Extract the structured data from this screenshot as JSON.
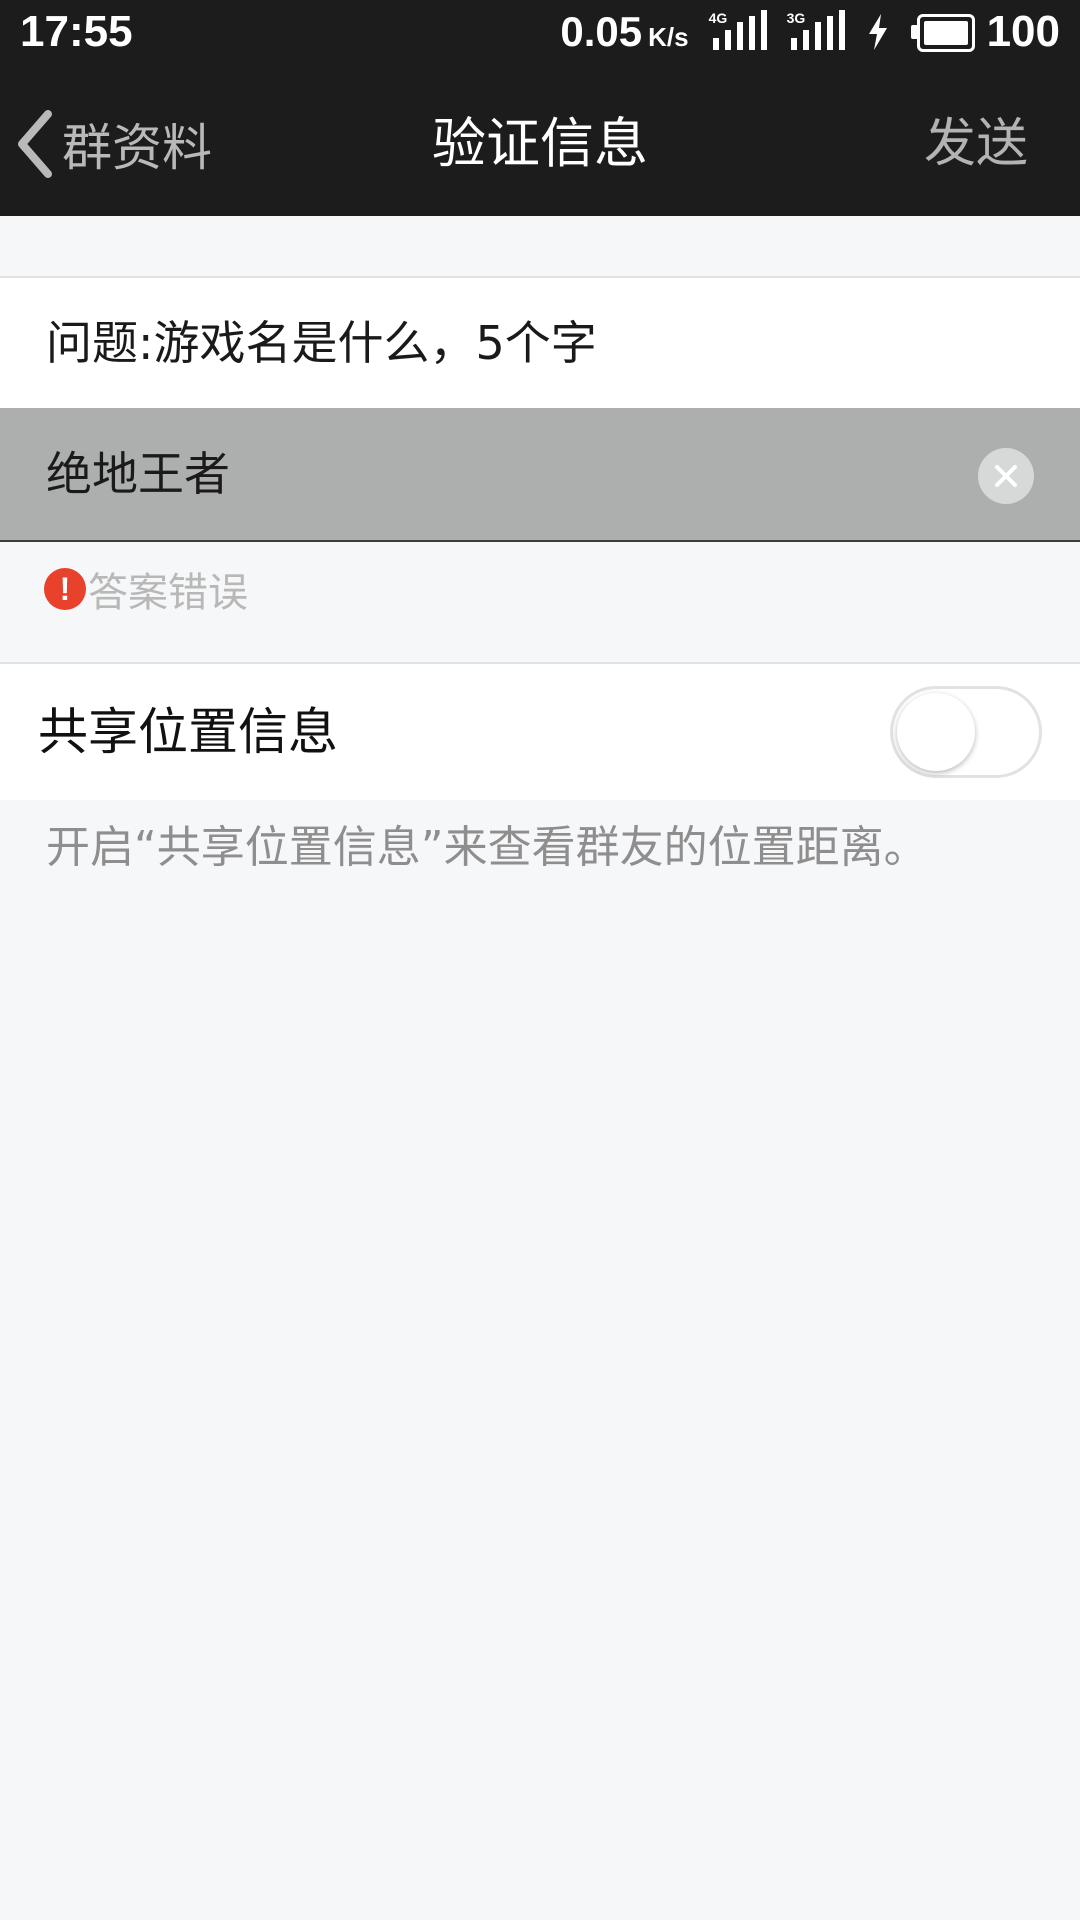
{
  "status_bar": {
    "time": "17:55",
    "net_speed": "0.05",
    "net_speed_unit": "K/s",
    "signal_1_tag": "4G",
    "signal_2_tag": "3G",
    "battery_level": "100",
    "icons": [
      "signal-icon",
      "signal-icon",
      "charging-icon",
      "battery-icon"
    ]
  },
  "nav": {
    "back_label": "群资料",
    "title": "验证信息",
    "send_label": "发送"
  },
  "form": {
    "question": "问题:游戏名是什么，5个字",
    "answer_value": "绝地王者",
    "error_text": "答案错误",
    "error_icon_glyph": "!"
  },
  "location": {
    "label": "共享位置信息",
    "enabled": false,
    "hint": "开启“共享位置信息”来查看群友的位置距离。"
  },
  "colors": {
    "bar_background": "#1c1c1c",
    "page_background": "#f6f7f9",
    "answer_background": "#adaeae",
    "error_red": "#e8412c"
  }
}
